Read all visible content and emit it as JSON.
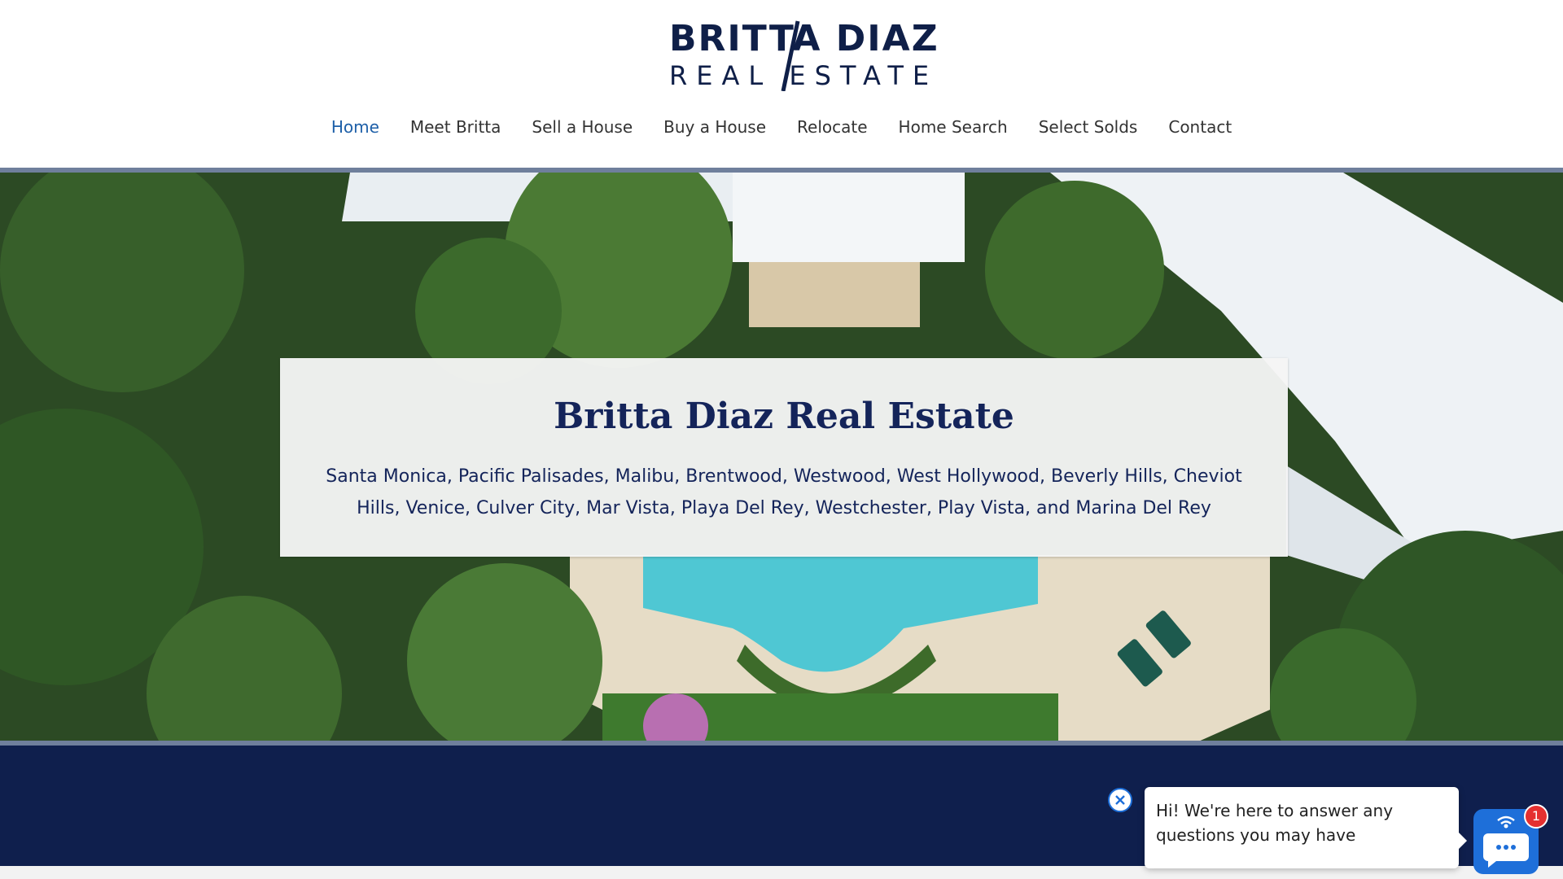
{
  "brand": {
    "line1": "BRITTA DIAZ",
    "line2": "REAL ESTATE",
    "color": "#0f1f48"
  },
  "nav": {
    "items": [
      {
        "label": "Home",
        "active": true
      },
      {
        "label": "Meet Britta",
        "active": false
      },
      {
        "label": "Sell a House",
        "active": false
      },
      {
        "label": "Buy a House",
        "active": false
      },
      {
        "label": "Relocate",
        "active": false
      },
      {
        "label": "Home Search",
        "active": false
      },
      {
        "label": "Select Solds",
        "active": false
      },
      {
        "label": "Contact",
        "active": false
      }
    ],
    "active_color": "#1d5fa8"
  },
  "hero": {
    "title": "Britta Diaz Real Estate",
    "subtitle": "Santa Monica, Pacific Palisades, Malibu, Brentwood, Westwood, West Hollywood, Beverly Hills, Cheviot Hills, Venice, Culver City, Mar Vista, Playa Del Rey, Westchester, Play Vista, and Marina Del Rey"
  },
  "chat": {
    "message": "Hi! We're here to answer any questions you may have",
    "unread_count": "1",
    "close_icon": "close-icon",
    "launcher_icon": "chat-icon",
    "accent": "#1e6fd9",
    "badge_color": "#e53030"
  },
  "colors": {
    "footer_band": "#0f1f4d",
    "divider": "#6f7f9c"
  }
}
